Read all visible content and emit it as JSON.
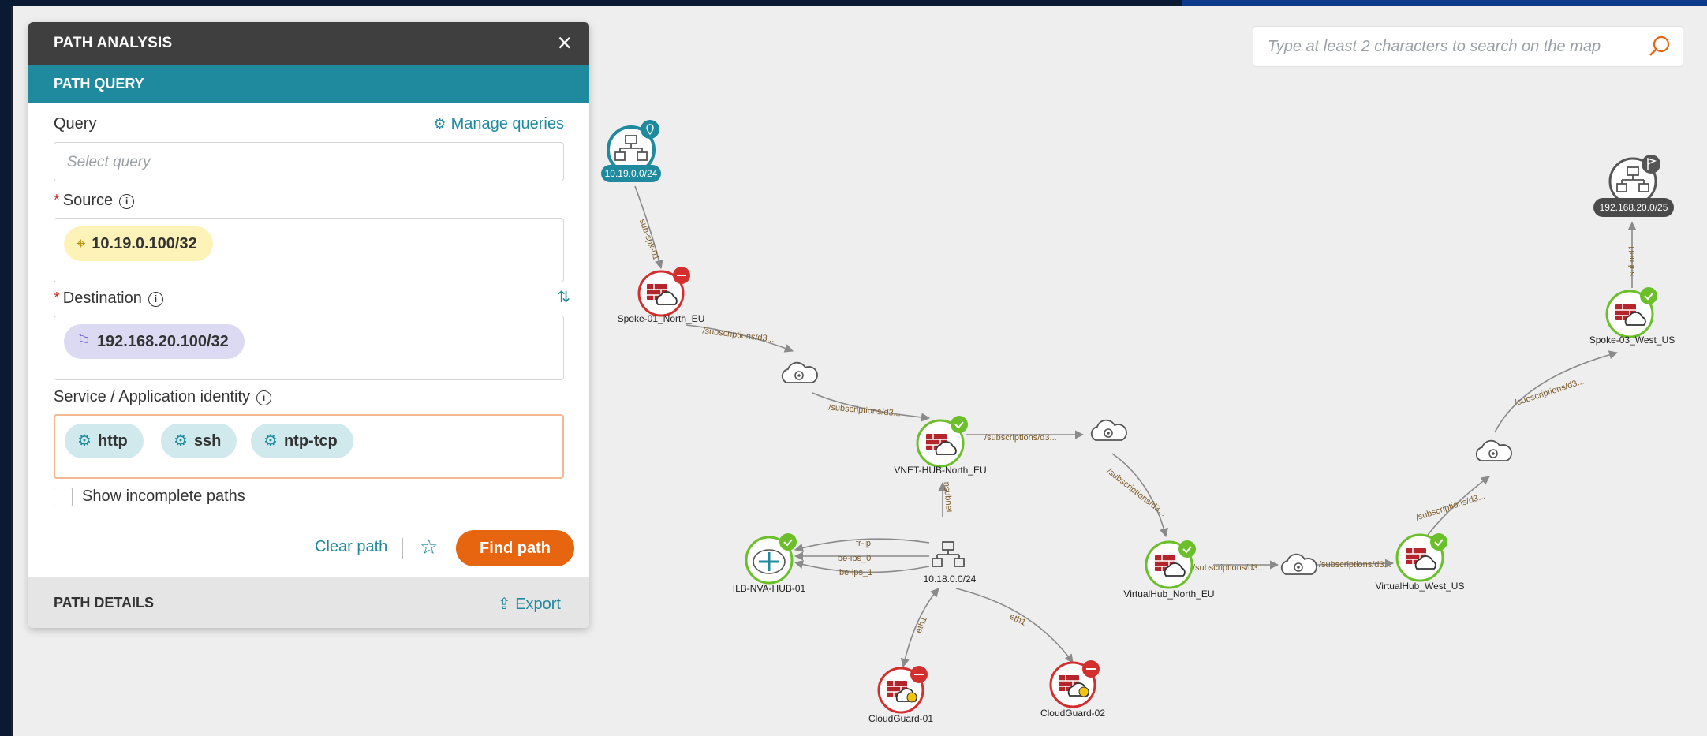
{
  "search": {
    "placeholder": "Type at least 2 characters to search on the map"
  },
  "panel": {
    "title": "PATH ANALYSIS",
    "close_label": "×",
    "query_section": "PATH QUERY",
    "query_label": "Query",
    "manage_queries": "Manage queries",
    "query_placeholder": "Select query",
    "source_label": "Source",
    "source_value": "10.19.0.100/32",
    "destination_label": "Destination",
    "destination_value": "192.168.20.100/32",
    "service_label": "Service / Application identity",
    "services": [
      "http",
      "ssh",
      "ntp-tcp"
    ],
    "show_incomplete": "Show incomplete paths",
    "clear_path": "Clear path",
    "find_path": "Find path",
    "details_title": "PATH DETAILS",
    "export": "Export"
  },
  "map": {
    "nodes": {
      "subnet_src": "10.19.0.0/24",
      "spoke01": "Spoke-01_North_EU",
      "vnet_hub": "VNET-HUB-North_EU",
      "ilb_nva": "ILB-NVA-HUB-01",
      "subnet_mid": "10.18.0.0/24",
      "cg01": "CloudGuard-01",
      "cg02": "CloudGuard-02",
      "vhub_eu": "VirtualHub_North_EU",
      "vhub_us": "VirtualHub_West_US",
      "spoke03": "Spoke-03_West_US",
      "subnet_dst": "192.168.20.0/25"
    },
    "edges": {
      "sub_spk": "sub-spk-01",
      "subs": "/subscriptions/d3...",
      "nsubnet": "nsubnet",
      "fr_ip": "fr-ip",
      "be_ips_0": "be-ips_0",
      "be_ips_1": "be-ips_1",
      "eth1": "eth1",
      "subnet1": "subnet1"
    }
  },
  "colors": {
    "teal": "#1f8a9d",
    "orange": "#e8650f",
    "green": "#6bbf2a",
    "red": "#d32f2f",
    "firewall": "#b5262c"
  }
}
